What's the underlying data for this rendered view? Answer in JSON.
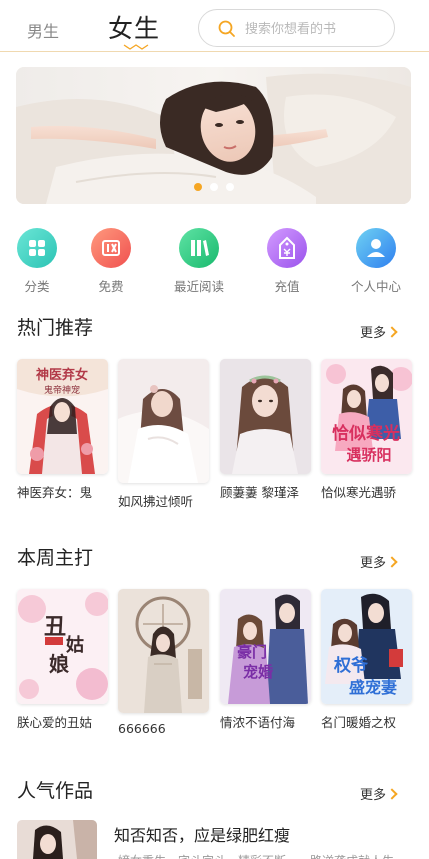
{
  "header": {
    "tabs": [
      {
        "label": "男生",
        "active": false
      },
      {
        "label": "女生",
        "active": true
      }
    ],
    "search_placeholder": "搜索你想看的书",
    "accent_color": "#f5a623"
  },
  "banner": {
    "slide_count": 3,
    "active_slide": 1
  },
  "quick_menu": [
    {
      "label": "分类",
      "icon": "grid-icon",
      "color": "#3fd3c3"
    },
    {
      "label": "免费",
      "icon": "free-tag-icon",
      "color": "#f76d5e"
    },
    {
      "label": "最近阅读",
      "icon": "books-icon",
      "color": "#2fce86"
    },
    {
      "label": "充值",
      "icon": "price-tag-icon",
      "color": "#b16ef0"
    },
    {
      "label": "个人中心",
      "icon": "user-icon",
      "color": "#3f8ff5"
    }
  ],
  "sections": [
    {
      "title": "热门推荐",
      "more_label": "更多",
      "books": [
        {
          "title": "神医弃女：鬼",
          "cover_text": "第医弃女鬼帝神宠",
          "cover_colors": [
            "#fbeef0",
            "#d94b4b"
          ]
        },
        {
          "title": "如风拂过倾听",
          "cover_text": "",
          "cover_colors": [
            "#f5eeee",
            "#c9b7b4"
          ]
        },
        {
          "title": "顾萋萋 黎瑾泽",
          "cover_text": "",
          "cover_colors": [
            "#e8e3e8",
            "#9a7b86"
          ]
        },
        {
          "title": "恰似寒光遇骄",
          "cover_text": "恰似寒光遇骄阳",
          "cover_colors": [
            "#fbe5ee",
            "#d8305f"
          ]
        }
      ]
    },
    {
      "title": "本周主打",
      "more_label": "更多",
      "books": [
        {
          "title": "朕心爱的丑姑",
          "cover_text": "丑姑娘",
          "cover_colors": [
            "#fbeef4",
            "#e29ab5"
          ]
        },
        {
          "title": "666666",
          "cover_text": "",
          "cover_colors": [
            "#f0ebe6",
            "#b69f8e"
          ]
        },
        {
          "title": "情浓不语付海",
          "cover_text": "豪门宠婚",
          "cover_colors": [
            "#f0ebf6",
            "#9a5fc4"
          ]
        },
        {
          "title": "名门暖婚之权",
          "cover_text": "权爷盛宠妻",
          "cover_colors": [
            "#e7f1fb",
            "#2f6fd6"
          ]
        }
      ]
    },
    {
      "title": "人气作品",
      "more_label": "更多"
    }
  ],
  "popular": {
    "title": "知否知否，应是绿肥红瘦",
    "desc": "嫡女重生，宅斗宫斗，精彩不断，一路逆袭成就人生"
  }
}
